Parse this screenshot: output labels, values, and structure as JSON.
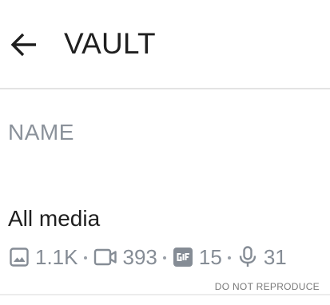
{
  "header": {
    "title": "VAULT",
    "back_icon": "arrow-left-icon"
  },
  "section": {
    "label": "NAME"
  },
  "item": {
    "title": "All media",
    "stats": {
      "images": {
        "icon": "image-icon",
        "count": "1.1K"
      },
      "videos": {
        "icon": "video-icon",
        "count": "393"
      },
      "gifs": {
        "icon": "gif-icon",
        "count": "15"
      },
      "audio": {
        "icon": "microphone-icon",
        "count": "31"
      },
      "separator": "•"
    }
  },
  "watermark": "DO NOT REPRODUCE",
  "colors": {
    "title": "#1f1f1f",
    "muted": "#858c95",
    "divider": "#e3e3e3"
  }
}
